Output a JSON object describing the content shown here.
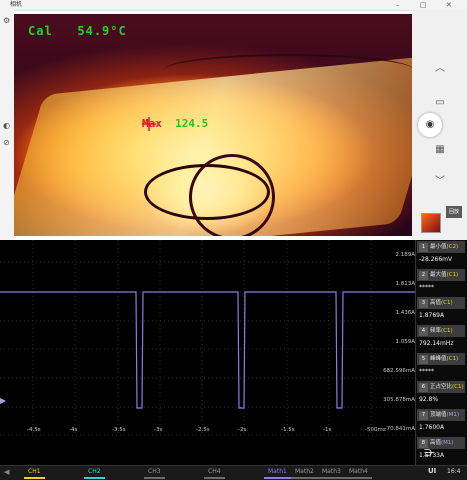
{
  "camera_window": {
    "title": "相机",
    "thermal": {
      "cal_label": "Cal",
      "cal_temp": "54.9°C",
      "max_label": "Max",
      "max_temp": "124.5"
    },
    "right_icons": [
      "chevron-up-icon",
      "video-icon",
      "camera-icon",
      "grid-icon",
      "chevron-down-icon"
    ],
    "thumb2_label": "回放"
  },
  "scope": {
    "trace_color": "#8c7ce6",
    "y_labels": [
      "2.189A",
      "1.813A",
      "1.436A",
      "1.059A",
      "682.596mA",
      "305.878mA",
      "-70.841mA"
    ],
    "x_labels": [
      "-4.5s",
      "-4s",
      "-3.5s",
      "-3s",
      "-2.5s",
      "-2s",
      "-1.5s",
      "-1s",
      "-500ms"
    ],
    "measurements": [
      {
        "num": "1",
        "name": "最小值",
        "src": "C2",
        "value": "-28.266mV",
        "src_class": "src-c"
      },
      {
        "num": "2",
        "name": "最大值",
        "src": "C1",
        "value": "*****",
        "src_class": "src-c"
      },
      {
        "num": "3",
        "name": "高值",
        "src": "C1",
        "value": "1.8769A",
        "src_class": "src-c"
      },
      {
        "num": "4",
        "name": "频率",
        "src": "C1",
        "value": "792.14mHz",
        "src_class": "src-c"
      },
      {
        "num": "5",
        "name": "峰峰值",
        "src": "C1",
        "value": "*****",
        "src_class": "src-c"
      },
      {
        "num": "6",
        "name": "正占空比",
        "src": "C1",
        "value": "92.8%",
        "src_class": "src-c"
      },
      {
        "num": "7",
        "name": "顶端值",
        "src": "M1",
        "value": "1.7600A",
        "src_class": "src-m"
      },
      {
        "num": "8",
        "name": "高值",
        "src": "M1",
        "value": "1.5733A",
        "src_class": "src-m"
      }
    ],
    "channels": [
      {
        "label": "CH1",
        "color": "#e8d428"
      },
      {
        "label": "CH2",
        "color": "#2fd3c8"
      },
      {
        "label": "CH3",
        "color": "#6a6a6a"
      },
      {
        "label": "CH4",
        "color": "#6a6a6a"
      },
      {
        "label": "Math1",
        "color": "#8c7ce6"
      },
      {
        "label": "Math2",
        "color": "#6a6a6a"
      },
      {
        "label": "Math3",
        "color": "#6a6a6a"
      },
      {
        "label": "Math4",
        "color": "#6a6a6a"
      }
    ],
    "brand": "UI",
    "time": "16:4"
  }
}
